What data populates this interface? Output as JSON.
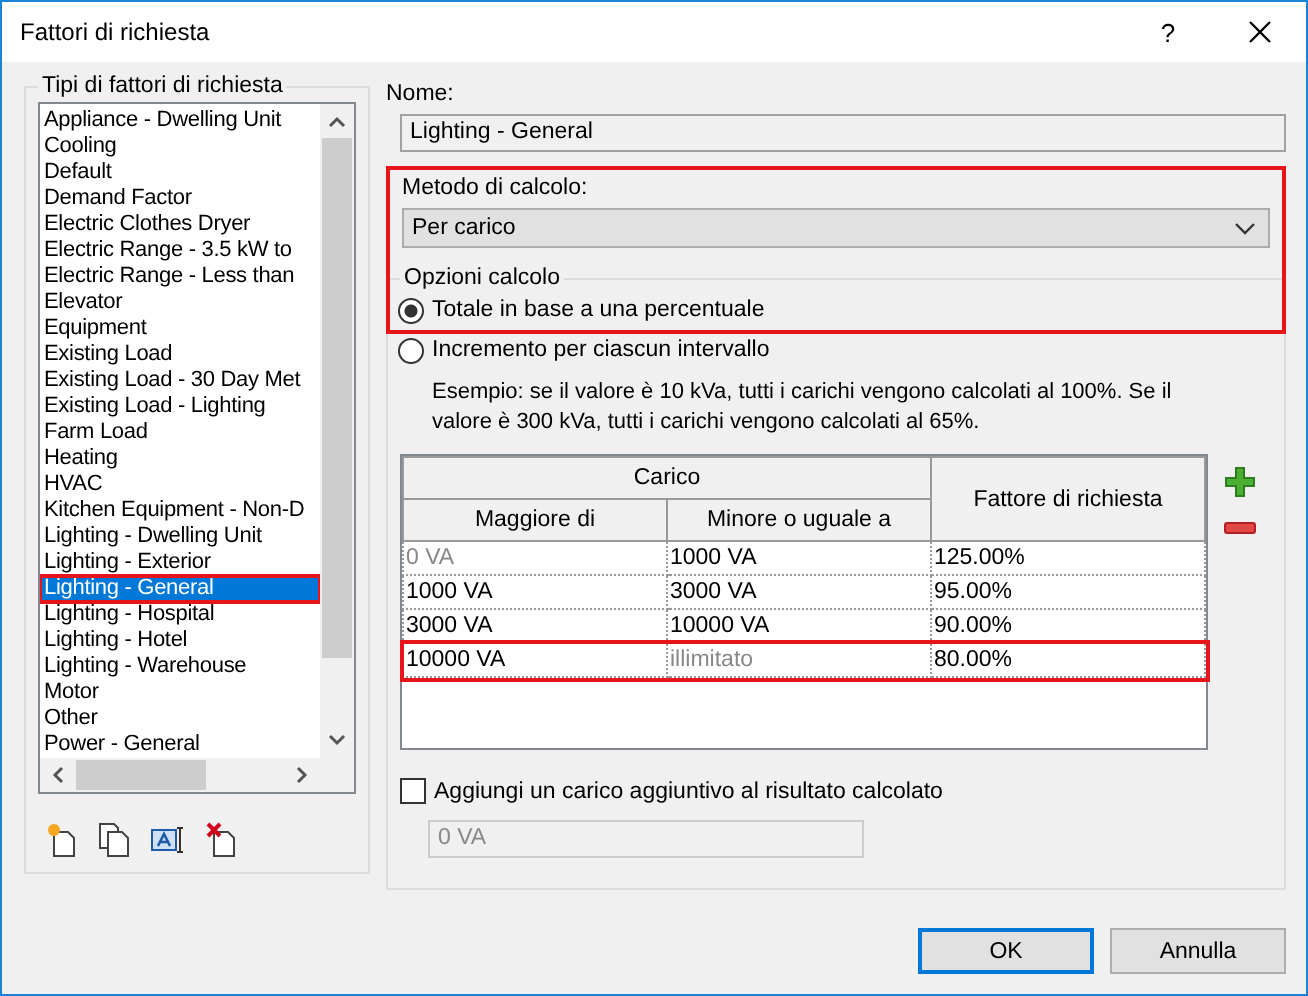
{
  "window": {
    "title": "Fattori di richiesta",
    "help": "?"
  },
  "types": {
    "label": "Tipi di fattori di richiesta",
    "items": [
      {
        "label": "Appliance - Dwelling Unit",
        "selected": false,
        "highlighted": false
      },
      {
        "label": "Cooling",
        "selected": false,
        "highlighted": false
      },
      {
        "label": "Default",
        "selected": false,
        "highlighted": false
      },
      {
        "label": "Demand Factor",
        "selected": false,
        "highlighted": false
      },
      {
        "label": "Electric Clothes Dryer",
        "selected": false,
        "highlighted": false
      },
      {
        "label": "Electric Range - 3.5 kW to",
        "selected": false,
        "highlighted": false
      },
      {
        "label": "Electric Range - Less than",
        "selected": false,
        "highlighted": false
      },
      {
        "label": "Elevator",
        "selected": false,
        "highlighted": false
      },
      {
        "label": "Equipment",
        "selected": false,
        "highlighted": false
      },
      {
        "label": "Existing Load",
        "selected": false,
        "highlighted": false
      },
      {
        "label": "Existing Load - 30 Day Met",
        "selected": false,
        "highlighted": false
      },
      {
        "label": "Existing Load - Lighting",
        "selected": false,
        "highlighted": false
      },
      {
        "label": "Farm Load",
        "selected": false,
        "highlighted": false
      },
      {
        "label": "Heating",
        "selected": false,
        "highlighted": false
      },
      {
        "label": "HVAC",
        "selected": false,
        "highlighted": false
      },
      {
        "label": "Kitchen Equipment - Non-D",
        "selected": false,
        "highlighted": false
      },
      {
        "label": "Lighting - Dwelling Unit",
        "selected": false,
        "highlighted": false
      },
      {
        "label": "Lighting - Exterior",
        "selected": false,
        "highlighted": false
      },
      {
        "label": "Lighting - General",
        "selected": true,
        "highlighted": true
      },
      {
        "label": "Lighting - Hospital",
        "selected": false,
        "highlighted": false
      },
      {
        "label": "Lighting - Hotel",
        "selected": false,
        "highlighted": false
      },
      {
        "label": "Lighting - Warehouse",
        "selected": false,
        "highlighted": false
      },
      {
        "label": "Motor",
        "selected": false,
        "highlighted": false
      },
      {
        "label": "Other",
        "selected": false,
        "highlighted": false
      },
      {
        "label": "Power - General",
        "selected": false,
        "highlighted": false
      }
    ]
  },
  "name": {
    "label": "Nome:",
    "value": "Lighting - General"
  },
  "method": {
    "label": "Metodo di calcolo:",
    "value": "Per carico",
    "highlighted": true
  },
  "options": {
    "label": "Opzioni calcolo",
    "radios": [
      {
        "label": "Totale in base a una percentuale",
        "selected": true
      },
      {
        "label": "Incremento per ciascun intervallo",
        "selected": false
      }
    ],
    "example": "Esempio: se il valore è 10 kVa, tutti i carichi vengono calcolati al 100%. Se il valore è 300 kVa, tutti i carichi vengono calcolati al 65%."
  },
  "table": {
    "group_header": "Carico",
    "columns": [
      "Maggiore di",
      "Minore o uguale a",
      "Fattore di richiesta"
    ],
    "rows": [
      {
        "cells": [
          {
            "text": "0 VA",
            "disabled": true
          },
          {
            "text": "1000 VA",
            "disabled": false
          },
          {
            "text": "125.00%",
            "disabled": false
          }
        ],
        "highlighted": false
      },
      {
        "cells": [
          {
            "text": "1000 VA",
            "disabled": false
          },
          {
            "text": "3000 VA",
            "disabled": false
          },
          {
            "text": "95.00%",
            "disabled": false
          }
        ],
        "highlighted": false
      },
      {
        "cells": [
          {
            "text": "3000 VA",
            "disabled": false
          },
          {
            "text": "10000 VA",
            "disabled": false
          },
          {
            "text": "90.00%",
            "disabled": false
          }
        ],
        "highlighted": false
      },
      {
        "cells": [
          {
            "text": "10000 VA",
            "disabled": false
          },
          {
            "text": "illimitato",
            "disabled": true
          },
          {
            "text": "80.00%",
            "disabled": false
          }
        ],
        "highlighted": true
      }
    ]
  },
  "additional": {
    "label": "Aggiungi un carico aggiuntivo al risultato calcolato",
    "checked": false,
    "value": "0 VA"
  },
  "buttons": [
    {
      "label": "OK",
      "default": true
    },
    {
      "label": "Annulla",
      "default": false
    }
  ]
}
